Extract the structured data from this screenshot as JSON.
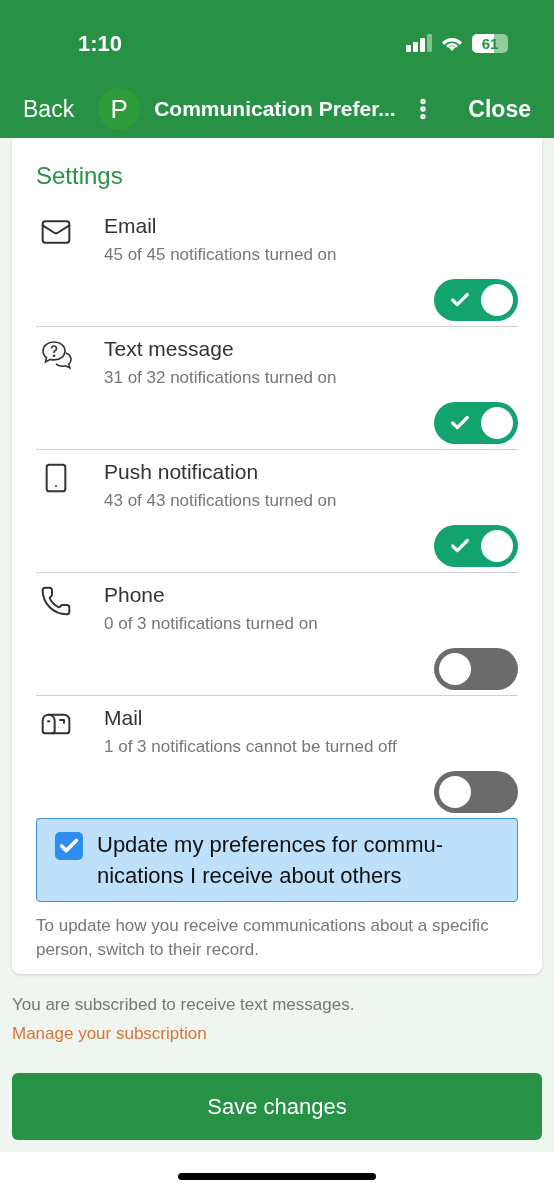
{
  "status_bar": {
    "time": "1:10",
    "battery": "61"
  },
  "nav": {
    "back": "Back",
    "avatar": "P",
    "title": "Communication Prefer...",
    "close": "Close"
  },
  "settings": {
    "title": "Settings",
    "channels": [
      {
        "kind": "email",
        "name": "Email",
        "summary": "45 of 45 notifications turned on",
        "on": true
      },
      {
        "kind": "chat",
        "name": "Text message",
        "summary": "31 of 32 notifications turned on",
        "on": true
      },
      {
        "kind": "mobile",
        "name": "Push notification",
        "summary": "43 of 43 notifications turned on",
        "on": true
      },
      {
        "kind": "phone",
        "name": "Phone",
        "summary": "0 of 3 notifications turned on",
        "on": false
      },
      {
        "kind": "mailbox",
        "name": "Mail",
        "summary": "1 of 3 notifications cannot be turned off",
        "on": false
      }
    ],
    "others": {
      "label": "Update my preferences for commu-nications I receive about others",
      "checked": true
    },
    "note": "To update how you receive communications about a specific person, switch to their record."
  },
  "subscription": {
    "text": "You are subscribed to receive text messages.",
    "link": "Manage your subscription"
  },
  "save": "Save changes"
}
